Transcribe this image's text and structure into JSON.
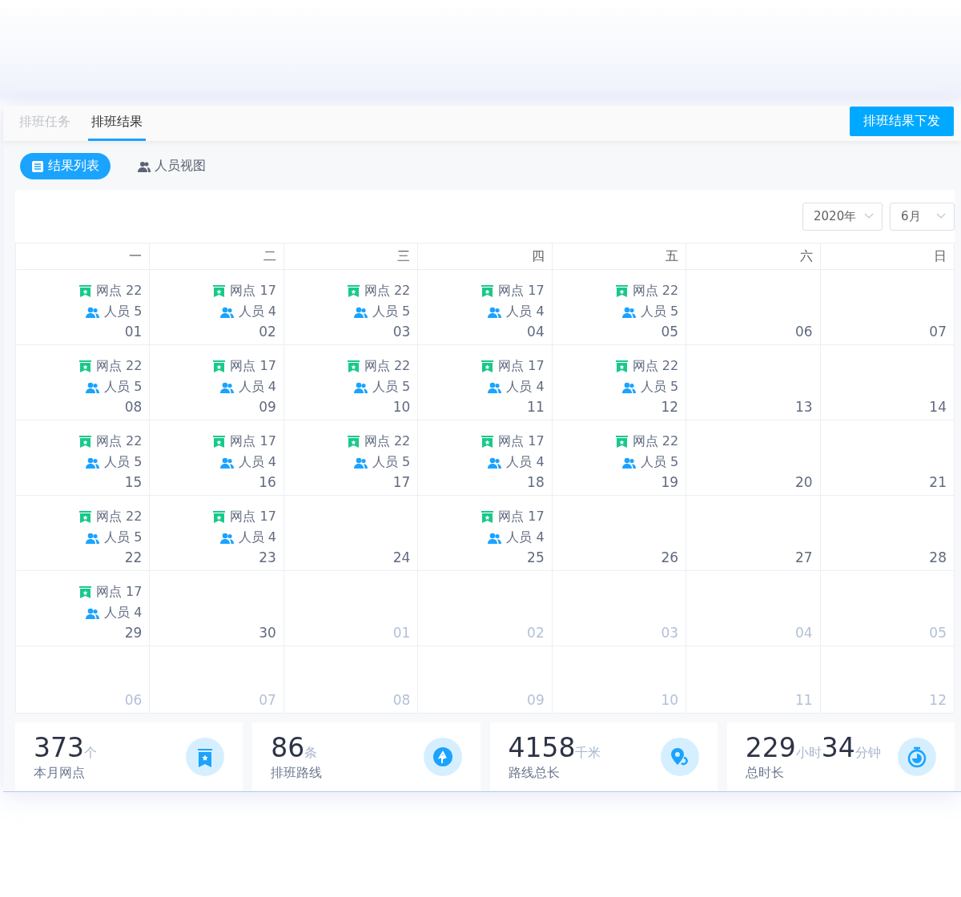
{
  "tabs": [
    {
      "label": "排班任务",
      "selected": false
    },
    {
      "label": "排班结果",
      "selected": true
    }
  ],
  "action_button": "排班结果下发",
  "view_switch": [
    {
      "label": "结果列表",
      "selected": true
    },
    {
      "label": "人员视图",
      "selected": false
    }
  ],
  "filters": {
    "year": "2020年",
    "month": "6月"
  },
  "weekdays": [
    "一",
    "二",
    "三",
    "四",
    "五",
    "六",
    "日"
  ],
  "weeks": [
    [
      {
        "date": "01",
        "muted": false,
        "sites": "网点 22",
        "staff": "人员 5"
      },
      {
        "date": "02",
        "muted": false,
        "sites": "网点 17",
        "staff": "人员 4"
      },
      {
        "date": "03",
        "muted": false,
        "sites": "网点 22",
        "staff": "人员 5"
      },
      {
        "date": "04",
        "muted": false,
        "sites": "网点 17",
        "staff": "人员 4"
      },
      {
        "date": "05",
        "muted": false,
        "sites": "网点 22",
        "staff": "人员 5"
      },
      {
        "date": "06",
        "muted": false
      },
      {
        "date": "07",
        "muted": false
      }
    ],
    [
      {
        "date": "08",
        "muted": false,
        "sites": "网点 22",
        "staff": "人员 5"
      },
      {
        "date": "09",
        "muted": false,
        "sites": "网点 17",
        "staff": "人员 4"
      },
      {
        "date": "10",
        "muted": false,
        "sites": "网点 22",
        "staff": "人员 5"
      },
      {
        "date": "11",
        "muted": false,
        "sites": "网点 17",
        "staff": "人员 4"
      },
      {
        "date": "12",
        "muted": false,
        "sites": "网点 22",
        "staff": "人员 5"
      },
      {
        "date": "13",
        "muted": false
      },
      {
        "date": "14",
        "muted": false
      }
    ],
    [
      {
        "date": "15",
        "muted": false,
        "sites": "网点 22",
        "staff": "人员 5"
      },
      {
        "date": "16",
        "muted": false,
        "sites": "网点 17",
        "staff": "人员 4"
      },
      {
        "date": "17",
        "muted": false,
        "sites": "网点 22",
        "staff": "人员 5"
      },
      {
        "date": "18",
        "muted": false,
        "sites": "网点 17",
        "staff": "人员 4"
      },
      {
        "date": "19",
        "muted": false,
        "sites": "网点 22",
        "staff": "人员 5"
      },
      {
        "date": "20",
        "muted": false
      },
      {
        "date": "21",
        "muted": false
      }
    ],
    [
      {
        "date": "22",
        "muted": false,
        "sites": "网点 22",
        "staff": "人员 5"
      },
      {
        "date": "23",
        "muted": false,
        "sites": "网点 17",
        "staff": "人员 4"
      },
      {
        "date": "24",
        "muted": false
      },
      {
        "date": "25",
        "muted": false,
        "sites": "网点 17",
        "staff": "人员 4"
      },
      {
        "date": "26",
        "muted": false
      },
      {
        "date": "27",
        "muted": false
      },
      {
        "date": "28",
        "muted": false
      }
    ],
    [
      {
        "date": "29",
        "muted": false,
        "sites": "网点 17",
        "staff": "人员 4"
      },
      {
        "date": "30",
        "muted": false
      },
      {
        "date": "01",
        "muted": true
      },
      {
        "date": "02",
        "muted": true
      },
      {
        "date": "03",
        "muted": true
      },
      {
        "date": "04",
        "muted": true
      },
      {
        "date": "05",
        "muted": true
      }
    ],
    [
      {
        "date": "06",
        "muted": true
      },
      {
        "date": "07",
        "muted": true
      },
      {
        "date": "08",
        "muted": true
      },
      {
        "date": "09",
        "muted": true
      },
      {
        "date": "10",
        "muted": true
      },
      {
        "date": "11",
        "muted": true
      },
      {
        "date": "12",
        "muted": true
      }
    ]
  ],
  "stats": [
    {
      "parts": [
        {
          "kind": "number",
          "text": "373"
        },
        {
          "kind": "unit",
          "text": "个"
        }
      ],
      "label": "本月网点"
    },
    {
      "parts": [
        {
          "kind": "number",
          "text": "86"
        },
        {
          "kind": "unit",
          "text": "条"
        }
      ],
      "label": "排班路线"
    },
    {
      "parts": [
        {
          "kind": "number",
          "text": "4158"
        },
        {
          "kind": "unit",
          "text": "千米"
        }
      ],
      "label": "路线总长"
    },
    {
      "parts": [
        {
          "kind": "number",
          "text": "229"
        },
        {
          "kind": "unit",
          "text": "小时"
        },
        {
          "kind": "number",
          "text": "34"
        },
        {
          "kind": "unit",
          "text": "分钟"
        }
      ],
      "label": "总时长"
    }
  ]
}
